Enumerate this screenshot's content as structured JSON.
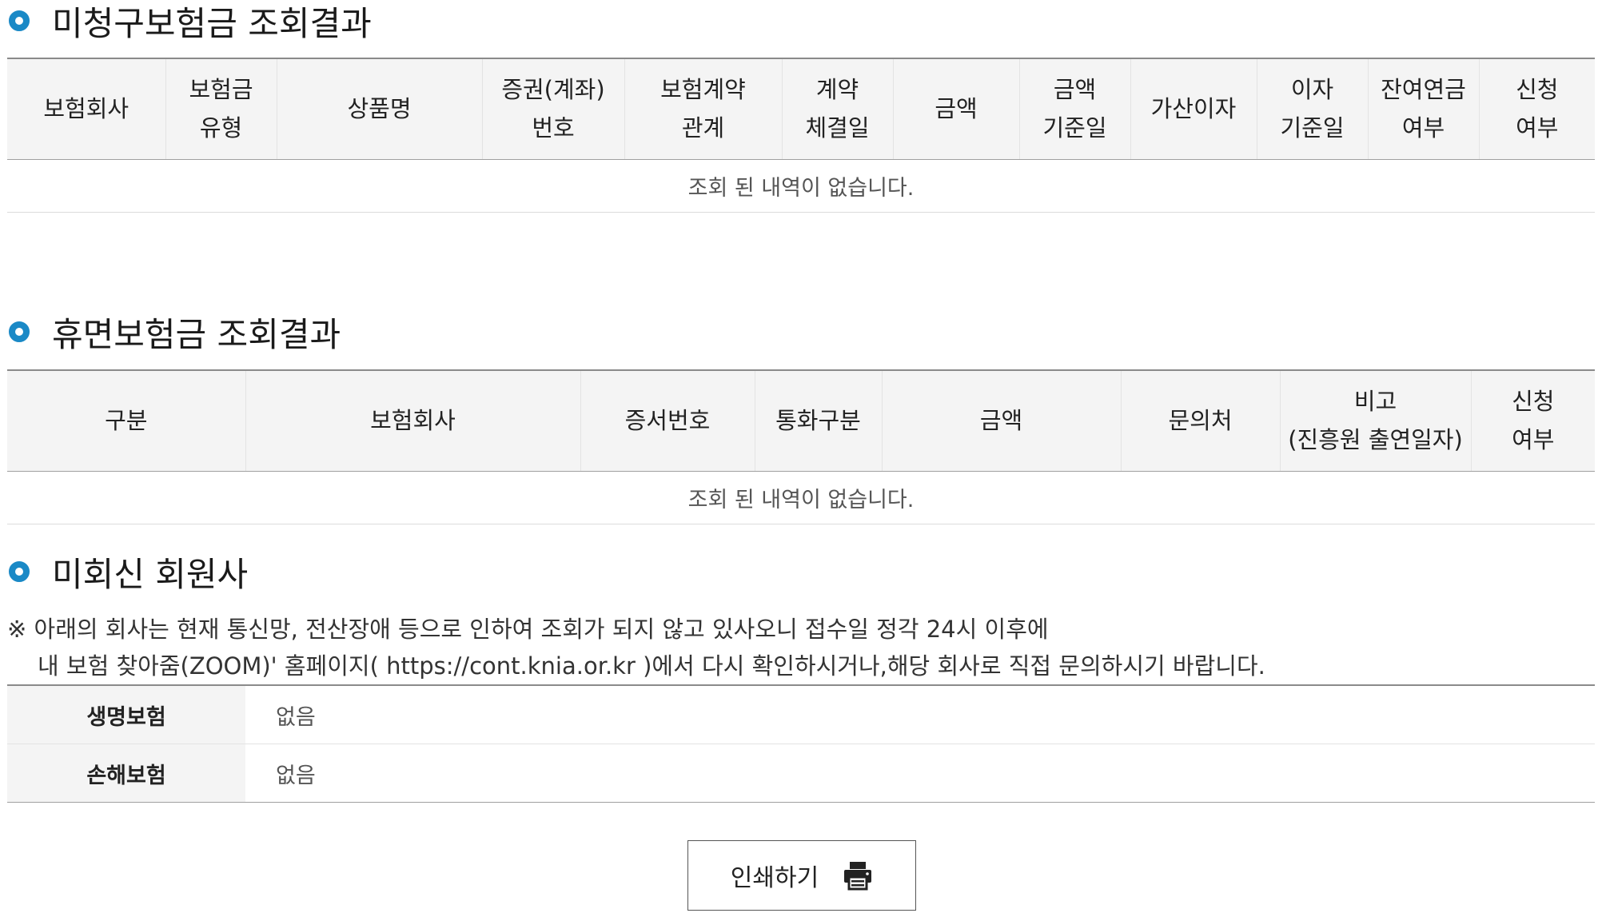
{
  "unclaimed": {
    "title": "미청구보험금 조회결과",
    "headers": [
      [
        "보험회사"
      ],
      [
        "보험금",
        "유형"
      ],
      [
        "상품명"
      ],
      [
        "증권(계좌)",
        "번호"
      ],
      [
        "보험계약",
        "관계"
      ],
      [
        "계약",
        "체결일"
      ],
      [
        "금액"
      ],
      [
        "금액",
        "기준일"
      ],
      [
        "가산이자"
      ],
      [
        "이자",
        "기준일"
      ],
      [
        "잔여연금",
        "여부"
      ],
      [
        "신청",
        "여부"
      ]
    ],
    "empty_message": "조회 된 내역이 없습니다."
  },
  "dormant": {
    "title": "휴면보험금 조회결과",
    "headers": [
      [
        "구분"
      ],
      [
        "보험회사"
      ],
      [
        "증서번호"
      ],
      [
        "통화구분"
      ],
      [
        "금액"
      ],
      [
        "문의처"
      ],
      [
        "비고",
        "(진흥원 출연일자)"
      ],
      [
        "신청",
        "여부"
      ]
    ],
    "empty_message": "조회 된 내역이 없습니다."
  },
  "no_reply": {
    "title": "미회신 회원사",
    "notice_line1": "※ 아래의 회사는 현재 통신망, 전산장애 등으로 인하여 조회가 되지 않고 있사오니 접수일 정각 24시 이후에",
    "notice_line2": "내 보험 찾아줌(ZOOM)' 홈페이지( https://cont.knia.or.kr )에서 다시 확인하시거나,해당 회사로 직접 문의하시기 바랍니다.",
    "rows": [
      {
        "label": "생명보험",
        "value": "없음"
      },
      {
        "label": "손해보험",
        "value": "없음"
      }
    ]
  },
  "print_button": {
    "label": "인쇄하기",
    "icon": "printer-icon"
  },
  "colors": {
    "bullet": "#1a89c6",
    "header_bg": "#f4f4f4"
  }
}
